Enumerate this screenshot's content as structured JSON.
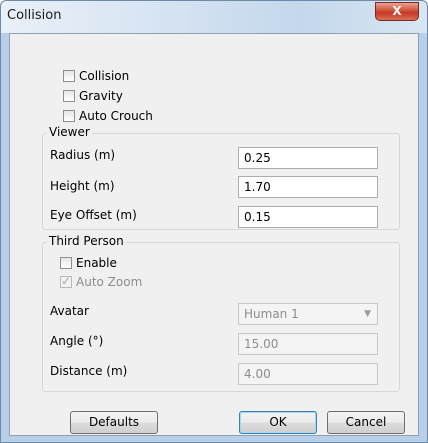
{
  "window": {
    "title": "Collision",
    "close_glyph": "X"
  },
  "options": {
    "collision": {
      "label": "Collision",
      "checked": false
    },
    "gravity": {
      "label": "Gravity",
      "checked": false
    },
    "auto_crouch": {
      "label": "Auto Crouch",
      "checked": false
    }
  },
  "viewer": {
    "title": "Viewer",
    "radius": {
      "label": "Radius (m)",
      "value": "0.25"
    },
    "height": {
      "label": "Height (m)",
      "value": "1.70"
    },
    "eye_offset": {
      "label": "Eye Offset (m)",
      "value": "0.15"
    }
  },
  "third_person": {
    "title": "Third Person",
    "enable": {
      "label": "Enable",
      "checked": false
    },
    "auto_zoom": {
      "label": "Auto Zoom",
      "checked": true,
      "disabled": true
    },
    "avatar": {
      "label": "Avatar",
      "value": "Human 1"
    },
    "angle": {
      "label": "Angle (°)",
      "value": "15.00"
    },
    "distance": {
      "label": "Distance (m)",
      "value": "4.00"
    }
  },
  "buttons": {
    "defaults": "Defaults",
    "ok": "OK",
    "cancel": "Cancel"
  },
  "icons": {
    "check": "check-icon",
    "dropdown": "chevron-down-icon",
    "close": "close-icon"
  }
}
